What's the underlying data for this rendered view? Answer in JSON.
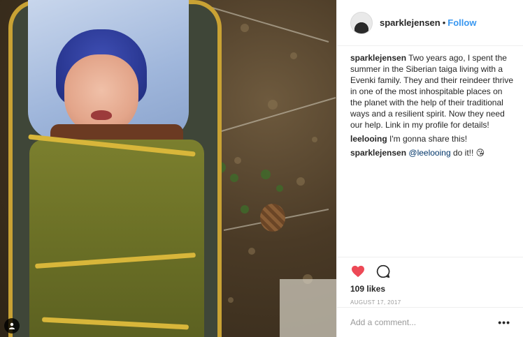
{
  "post": {
    "username": "sparklejensen",
    "separator": "•",
    "follow_label": "Follow"
  },
  "comments": [
    {
      "user": "sparklejensen",
      "text": "Two years ago, I spent the summer in the Siberian taiga living with a Evenki family. They and their reindeer thrive in one of the most inhospitable places on the planet with the help of their traditional ways and a resilient spirit. Now they need our help. Link in my profile for details!"
    },
    {
      "user": "leelooing",
      "text": "I'm gonna share this!"
    },
    {
      "user": "sparklejensen",
      "mention": "@leelooing",
      "text": "do it!!",
      "emoji": "😘"
    }
  ],
  "actions": {
    "like_icon": "heart-filled-icon",
    "comment_icon": "comment-bubble-icon",
    "like_color": "#ed4956"
  },
  "likes_text": "109 likes",
  "date": "AUGUST 17, 2017",
  "add_comment": {
    "placeholder": "Add a comment...",
    "more_label": "•••"
  },
  "photo": {
    "tag_icon": "user-tag-icon"
  }
}
